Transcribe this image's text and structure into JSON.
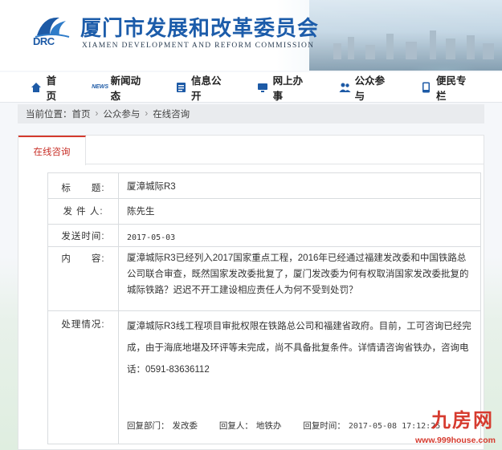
{
  "header": {
    "logo_text": "DRC",
    "title": "厦门市发展和改革委员会",
    "subtitle": "XIAMEN DEVELOPMENT AND REFORM COMMISSION"
  },
  "nav": {
    "items": [
      {
        "label": "首页",
        "icon": "home-icon"
      },
      {
        "label": "新闻动态",
        "icon": "news-icon"
      },
      {
        "label": "信息公开",
        "icon": "document-icon"
      },
      {
        "label": "网上办事",
        "icon": "monitor-icon"
      },
      {
        "label": "公众参与",
        "icon": "people-icon"
      },
      {
        "label": "便民专栏",
        "icon": "phone-icon"
      }
    ]
  },
  "breadcrumb": {
    "prefix": "当前位置：",
    "items": [
      "首页",
      "公众参与",
      "在线咨询"
    ]
  },
  "tab": {
    "label": "在线咨询"
  },
  "form": {
    "title_label": "标　　题:",
    "title_value": "厦漳城际R3",
    "sender_label": "发 件 人:",
    "sender_value": "陈先生",
    "date_label": "发送时间:",
    "date_value": "2017-05-03",
    "content_label": "内　　容:",
    "content_value": "厦漳城际R3已经列入2017国家重点工程，2016年已经通过福建发改委和中国铁路总公司联合审查，既然国家发改委批复了，厦门发改委为何有权取消国家发改委批复的城际铁路？迟迟不开工建设相应责任人为何不受到处罚？",
    "reply_label": "处理情况:",
    "reply_value": "厦漳城际R3线工程项目审批权限在铁路总公司和福建省政府。目前，工可咨询已经完成，由于海底地堪及环评等未完成，尚不具备批复条件。详情请咨询省铁办，咨询电话：0591-83636112",
    "reply_dept_label": "回复部门：",
    "reply_dept_value": "发改委",
    "replier_label": "回复人：",
    "replier_value": "地铁办",
    "reply_time_label": "回复时间：",
    "reply_time_value": "2017-05-08 17:12:25"
  },
  "watermark": {
    "brand": "九房网",
    "url": "www.999house.com"
  },
  "colors": {
    "brand_blue": "#1c5caa",
    "accent_red": "#d43a2e"
  }
}
